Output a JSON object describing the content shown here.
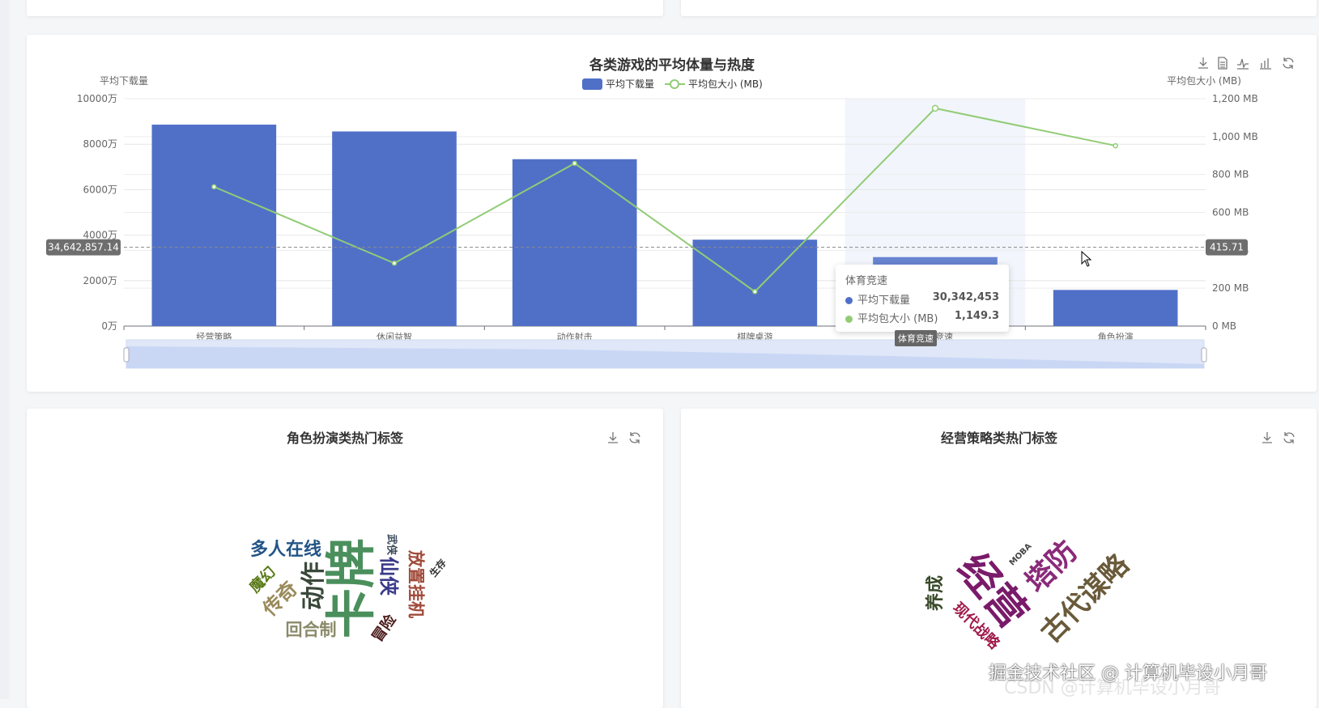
{
  "main_chart": {
    "toolbox": [
      "download-icon",
      "data-view-icon",
      "line-switch-icon",
      "bar-switch-icon",
      "restore-icon"
    ],
    "tooltip": {
      "category": "体育竞速",
      "rows": [
        {
          "label": "平均下载量",
          "value": "30,342,453"
        },
        {
          "label": "平均包大小 (MB)",
          "value": "1,149.3"
        }
      ]
    },
    "highlight_label": "体育竞速"
  },
  "chart_data": {
    "type": "bar",
    "title": "各类游戏的平均体量与热度",
    "categories": [
      "经营策略",
      "休闲益智",
      "动作射击",
      "棋牌桌游",
      "体育竞速",
      "角色扮演"
    ],
    "series": [
      {
        "name": "平均下载量",
        "type": "bar",
        "axis": "left",
        "color": "#5070c8",
        "values": [
          88600000,
          85600000,
          73400000,
          38000000,
          30342453,
          15900000
        ]
      },
      {
        "name": "平均包大小 (MB)",
        "type": "line",
        "axis": "right",
        "color": "#91cc75",
        "values": [
          735,
          332,
          859,
          182,
          1149.3,
          952
        ]
      }
    ],
    "left_axis": {
      "name": "平均下载量",
      "min": 0,
      "max": 100000000,
      "ticks": [
        "0万",
        "2000万",
        "4000万",
        "6000万",
        "8000万",
        "10000万"
      ]
    },
    "right_axis": {
      "name": "平均包大小 (MB)",
      "min": 0,
      "max": 1200,
      "ticks": [
        "0 MB",
        "200 MB",
        "400 MB",
        "600 MB",
        "800 MB",
        "1,000 MB",
        "1,200 MB"
      ]
    },
    "mark_lines": {
      "left_label": "34,642,857.14",
      "left_value": 34642857.14,
      "right_label": "415.71",
      "right_value": 415.71
    },
    "legend": [
      "平均下载量",
      "平均包大小 (MB)"
    ],
    "legend_position": "top-center",
    "grid": true
  },
  "cloud_left": {
    "title": "角色扮演类热门标签",
    "words": [
      "多人在线",
      "卡牌",
      "动作",
      "魔幻",
      "传奇",
      "回合制",
      "武侠",
      "仙侠",
      "放置挂机",
      "生存",
      "冒险"
    ]
  },
  "cloud_right": {
    "title": "经营策略类热门标签",
    "words": [
      "养成",
      "经营",
      "塔防",
      "古代谋略",
      "MOBA",
      "现代战略"
    ]
  },
  "watermark": "掘金技术社区 @ 计算机毕设小月哥",
  "watermark2": "CSDN @计算机毕设小月哥"
}
